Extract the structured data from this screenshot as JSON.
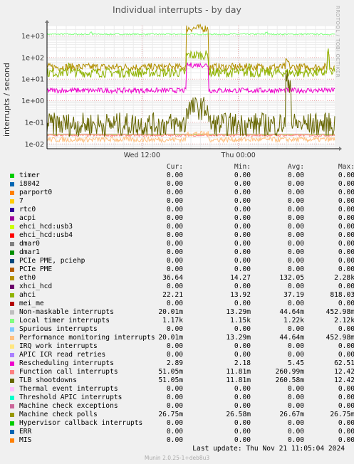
{
  "title": "Individual interrupts - by day",
  "side_label": "RRDTOOL / TOBI OETIKER",
  "footer": {
    "last_update_label": "Last update:",
    "last_update_value": "Thu Nov 21 11:05:04 2024",
    "generator": "Munin 2.0.25-1+deb8u3"
  },
  "columns": {
    "cur": "Cur:",
    "min": "Min:",
    "avg": "Avg:",
    "max": "Max:"
  },
  "legend": [
    {
      "name": "timer",
      "color": "#00cc00",
      "cur": "0.00",
      "min": "0.00",
      "avg": "0.00",
      "max": "0.00"
    },
    {
      "name": "i8042",
      "color": "#0066b3",
      "cur": "0.00",
      "min": "0.00",
      "avg": "0.00",
      "max": "0.00"
    },
    {
      "name": "parport0",
      "color": "#ff8000",
      "cur": "0.00",
      "min": "0.00",
      "avg": "0.00",
      "max": "0.00"
    },
    {
      "name": "7",
      "color": "#ffcc00",
      "cur": "0.00",
      "min": "0.00",
      "avg": "0.00",
      "max": "0.00"
    },
    {
      "name": "rtc0",
      "color": "#330099",
      "cur": "0.00",
      "min": "0.00",
      "avg": "0.00",
      "max": "0.00"
    },
    {
      "name": "acpi",
      "color": "#990099",
      "cur": "0.00",
      "min": "0.00",
      "avg": "0.00",
      "max": "0.00"
    },
    {
      "name": "ehci_hcd:usb3",
      "color": "#ccff00",
      "cur": "0.00",
      "min": "0.00",
      "avg": "0.00",
      "max": "0.00"
    },
    {
      "name": "ehci_hcd:usb4",
      "color": "#ff0000",
      "cur": "0.00",
      "min": "0.00",
      "avg": "0.00",
      "max": "0.00"
    },
    {
      "name": "dmar0",
      "color": "#808080",
      "cur": "0.00",
      "min": "0.00",
      "avg": "0.00",
      "max": "0.00"
    },
    {
      "name": "dmar1",
      "color": "#008f00",
      "cur": "0.00",
      "min": "0.00",
      "avg": "0.00",
      "max": "0.00"
    },
    {
      "name": "PCIe PME, pciehp",
      "color": "#00487d",
      "cur": "0.00",
      "min": "0.00",
      "avg": "0.00",
      "max": "0.00"
    },
    {
      "name": "PCIe PME",
      "color": "#b35a00",
      "cur": "0.00",
      "min": "0.00",
      "avg": "0.00",
      "max": "0.00"
    },
    {
      "name": "eth0",
      "color": "#b38f00",
      "cur": "36.64",
      "min": "14.27",
      "avg": "132.05",
      "max": "2.28k"
    },
    {
      "name": "xhci_hcd",
      "color": "#6b006b",
      "cur": "0.00",
      "min": "0.00",
      "avg": "0.00",
      "max": "0.00"
    },
    {
      "name": "ahci",
      "color": "#8fb300",
      "cur": "22.21",
      "min": "13.92",
      "avg": "37.19",
      "max": "818.03"
    },
    {
      "name": "mei_me",
      "color": "#b30000",
      "cur": "0.00",
      "min": "0.00",
      "avg": "0.00",
      "max": "0.00"
    },
    {
      "name": "Non-maskable interrupts",
      "color": "#bebebe",
      "cur": "20.01m",
      "min": "13.29m",
      "avg": "44.64m",
      "max": "452.98m"
    },
    {
      "name": "Local timer interrupts",
      "color": "#80ff80",
      "cur": "1.17k",
      "min": "1.15k",
      "avg": "1.22k",
      "max": "2.12k"
    },
    {
      "name": "Spurious interrupts",
      "color": "#80c9ff",
      "cur": "0.00",
      "min": "0.00",
      "avg": "0.00",
      "max": "0.00"
    },
    {
      "name": "Performance monitoring interrupts",
      "color": "#ffc080",
      "cur": "20.01m",
      "min": "13.29m",
      "avg": "44.64m",
      "max": "452.98m"
    },
    {
      "name": "IRQ work interrupts",
      "color": "#ffe680",
      "cur": "0.00",
      "min": "0.00",
      "avg": "0.00",
      "max": "0.00"
    },
    {
      "name": "APIC ICR read retries",
      "color": "#aa80ff",
      "cur": "0.00",
      "min": "0.00",
      "avg": "0.00",
      "max": "0.00"
    },
    {
      "name": "Rescheduling interrupts",
      "color": "#ee00cc",
      "cur": "2.89",
      "min": "2.18",
      "avg": "5.45",
      "max": "62.51"
    },
    {
      "name": "Function call interrupts",
      "color": "#ff8080",
      "cur": "51.05m",
      "min": "11.81m",
      "avg": "260.99m",
      "max": "12.42"
    },
    {
      "name": "TLB shootdowns",
      "color": "#666600",
      "cur": "51.05m",
      "min": "11.81m",
      "avg": "260.58m",
      "max": "12.42"
    },
    {
      "name": "Thermal event interrupts",
      "color": "#ffbfff",
      "cur": "0.00",
      "min": "0.00",
      "avg": "0.00",
      "max": "0.00"
    },
    {
      "name": "Threshold APIC interrupts",
      "color": "#00ffcc",
      "cur": "0.00",
      "min": "0.00",
      "avg": "0.00",
      "max": "0.00"
    },
    {
      "name": "Machine check exceptions",
      "color": "#cc6699",
      "cur": "0.00",
      "min": "0.00",
      "avg": "0.00",
      "max": "0.00"
    },
    {
      "name": "Machine check polls",
      "color": "#999900",
      "cur": "26.75m",
      "min": "26.58m",
      "avg": "26.67m",
      "max": "26.75m"
    },
    {
      "name": "Hypervisor callback interrupts",
      "color": "#00cc00",
      "cur": "0.00",
      "min": "0.00",
      "avg": "0.00",
      "max": "0.00"
    },
    {
      "name": "ERR",
      "color": "#0066b3",
      "cur": "0.00",
      "min": "0.00",
      "avg": "0.00",
      "max": "0.00"
    },
    {
      "name": "MIS",
      "color": "#ff8000",
      "cur": "0.00",
      "min": "0.00",
      "avg": "0.00",
      "max": "0.00"
    }
  ],
  "chart_data": {
    "type": "line",
    "title": "Individual interrupts - by day",
    "ylabel": "interrupts / second",
    "xlabel": "",
    "yscale": "log",
    "ylim": [
      0.006,
      3000
    ],
    "y_ticks": [
      "1e-02",
      "1e-01",
      "1e+00",
      "1e+01",
      "1e+02",
      "1e+03"
    ],
    "x_ticks": [
      "Wed 12:00",
      "Thu 00:00"
    ],
    "x_tick_pos": [
      0.33,
      0.665
    ],
    "grid": true,
    "series": [
      {
        "name": "Local timer interrupts",
        "color": "#80ff80",
        "base": 1200,
        "noise": 0.03,
        "events": [
          {
            "from": 0.15,
            "to": 0.155,
            "value": 1500
          },
          {
            "from": 0.76,
            "to": 0.765,
            "value": 1500
          }
        ]
      },
      {
        "name": "eth0",
        "color": "#b38f00",
        "base": 36,
        "noise": 0.18,
        "events": [
          {
            "from": 0.485,
            "to": 0.56,
            "value": 2280
          },
          {
            "from": 0.83,
            "to": 0.84,
            "value": 60
          },
          {
            "from": 0.975,
            "to": 0.982,
            "value": 160
          }
        ]
      },
      {
        "name": "ahci",
        "color": "#8fb300",
        "base": 20,
        "noise": 0.22,
        "events": [
          {
            "from": 0.485,
            "to": 0.56,
            "value": 130
          },
          {
            "from": 0.075,
            "to": 0.08,
            "value": 60
          },
          {
            "from": 0.7,
            "to": 0.705,
            "value": 50
          },
          {
            "from": 0.975,
            "to": 0.982,
            "value": 160
          }
        ]
      },
      {
        "name": "Rescheduling interrupts",
        "color": "#ee00cc",
        "base": 3.0,
        "noise": 0.12,
        "events": [
          {
            "from": 0.485,
            "to": 0.56,
            "value": 45
          }
        ]
      },
      {
        "name": "Machine check polls",
        "color": "#999900",
        "base": 0.027,
        "noise": 0.0,
        "events": []
      },
      {
        "name": "Function call interrupts",
        "color": "#ff8080",
        "base": 0.025,
        "noise": 0.05,
        "events": []
      },
      {
        "name": "Performance monitoring interrupts",
        "color": "#ffc080",
        "base": 0.016,
        "noise": 0.12,
        "events": [
          {
            "from": 0.485,
            "to": 0.56,
            "value": 0.03
          }
        ]
      },
      {
        "name": "TLB shootdowns",
        "color": "#666600",
        "base": 0.08,
        "noise": 0.55,
        "events": [
          {
            "from": 0.485,
            "to": 0.56,
            "value": 0.45
          },
          {
            "from": 0.83,
            "to": 0.848,
            "value": 8
          }
        ]
      }
    ]
  }
}
